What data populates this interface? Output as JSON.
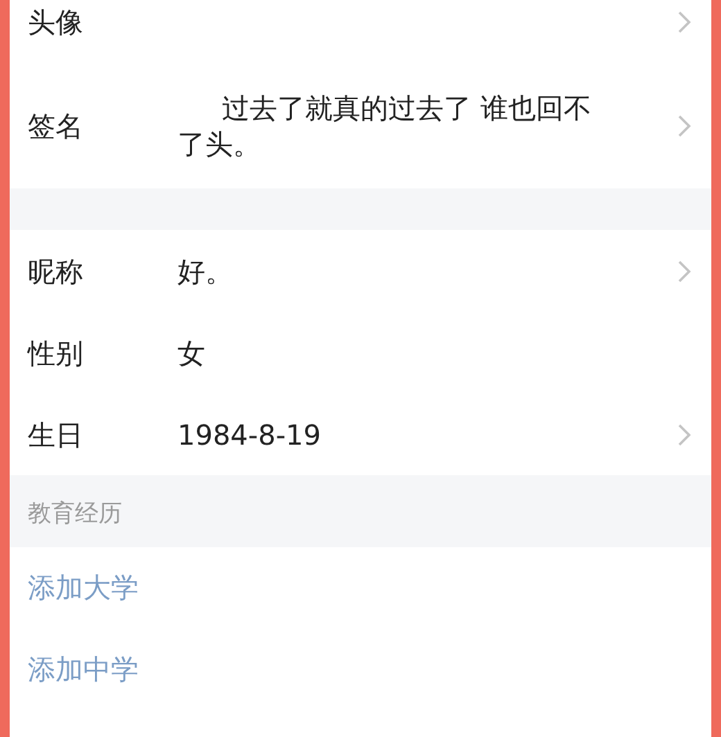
{
  "profile_rows": [
    {
      "label": "头像",
      "chevron": true
    },
    {
      "label": "签名",
      "value": "过去了就真的过去了  谁也回不了头。",
      "chevron": true
    }
  ],
  "basic_rows": [
    {
      "label": "昵称",
      "value": "好。",
      "chevron": true
    },
    {
      "label": "性别",
      "value": "女",
      "chevron": false
    },
    {
      "label": "生日",
      "value": "1984-8-19",
      "chevron": true
    }
  ],
  "education": {
    "header": "教育经历",
    "actions": [
      "添加大学",
      "添加中学"
    ]
  }
}
